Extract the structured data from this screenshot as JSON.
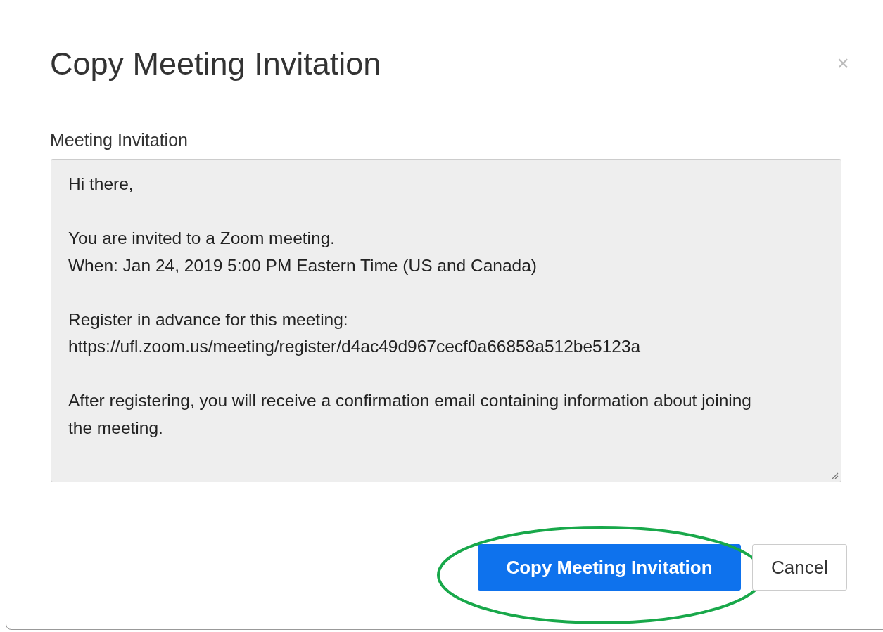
{
  "dialog": {
    "title": "Copy Meeting Invitation",
    "close": "×"
  },
  "field": {
    "label": "Meeting Invitation",
    "value": "Hi there,\n\nYou are invited to a Zoom meeting.\nWhen: Jan 24, 2019 5:00 PM Eastern Time (US and Canada)\n\nRegister in advance for this meeting:\nhttps://ufl.zoom.us/meeting/register/d4ac49d967cecf0a66858a512be5123a\n\nAfter registering, you will receive a confirmation email containing information about joining the meeting."
  },
  "buttons": [
    {
      "label": "Copy Meeting Invitation",
      "kind": "primary",
      "highlighted": true
    },
    {
      "label": "Cancel",
      "kind": "secondary",
      "highlighted": false
    }
  ]
}
